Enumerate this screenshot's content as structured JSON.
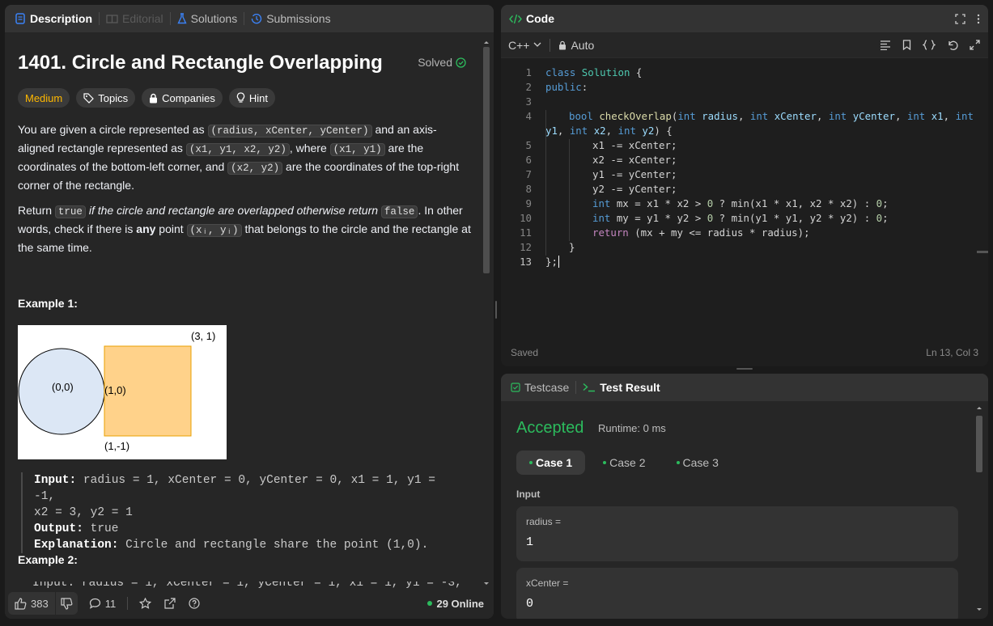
{
  "left_tabs": {
    "description": "Description",
    "editorial": "Editorial",
    "solutions": "Solutions",
    "submissions": "Submissions"
  },
  "problem": {
    "title": "1401. Circle and Rectangle Overlapping",
    "solved": "Solved",
    "difficulty": "Medium",
    "topics": "Topics",
    "companies": "Companies",
    "hint": "Hint"
  },
  "para1": {
    "t1": "You are given a circle represented as ",
    "c1": "(radius, xCenter, yCenter)",
    "t2": " and an axis-aligned rectangle represented as ",
    "c2": "(x1, y1, x2, y2)",
    "t3": ", where ",
    "c3": "(x1, y1)",
    "t4": " are the coordinates of the bottom-left corner, and ",
    "c4": "(x2, y2)",
    "t5": " are the coordinates of the top-right corner of the rectangle."
  },
  "para2": {
    "t1": "Return ",
    "c1": "true",
    "t2": " if the circle and rectangle are overlapped otherwise return ",
    "c2": "false",
    "t3": ". In other words, check if there is ",
    "b1": "any",
    "t4": " point ",
    "c3": "(xᵢ, yᵢ)",
    "t5": " that belongs to the circle and the rectangle at the same time."
  },
  "example1": {
    "heading": "Example 1:",
    "input_label": "Input:",
    "input": " radius = 1, xCenter = 0, yCenter = 0, x1 = 1, y1 = -1,",
    "input2": "x2 = 3, y2 = 1",
    "output_label": "Output:",
    "output": " true",
    "expl_label": "Explanation:",
    "expl": " Circle and rectangle share the point (1,0)."
  },
  "figure": {
    "center": "(0,0)",
    "touch": "(1,0)",
    "top_right": "(3, 1)",
    "bottom": "(1,-1)"
  },
  "example2": {
    "heading": "Example 2:",
    "input_partial": "Input: radius = 1, xCenter = 1, yCenter = 1, x1 = 1, y1 = -3,"
  },
  "bottom": {
    "likes": "383",
    "comments": "11",
    "online": "29 Online"
  },
  "code": {
    "title": "Code",
    "language": "C++",
    "mode": "Auto",
    "status": "Saved",
    "cursor": "Ln 13, Col 3"
  },
  "result": {
    "tab_testcase": "Testcase",
    "tab_result": "Test Result",
    "verdict": "Accepted",
    "runtime": "Runtime: 0 ms",
    "cases": [
      "Case 1",
      "Case 2",
      "Case 3"
    ],
    "input_label": "Input",
    "var1": "radius =",
    "val1": "1",
    "var2": "xCenter =",
    "val2": "0"
  },
  "colors": {
    "accepted": "#2cbb5d",
    "medium": "#ffb800",
    "keyword": "#569cd6"
  }
}
